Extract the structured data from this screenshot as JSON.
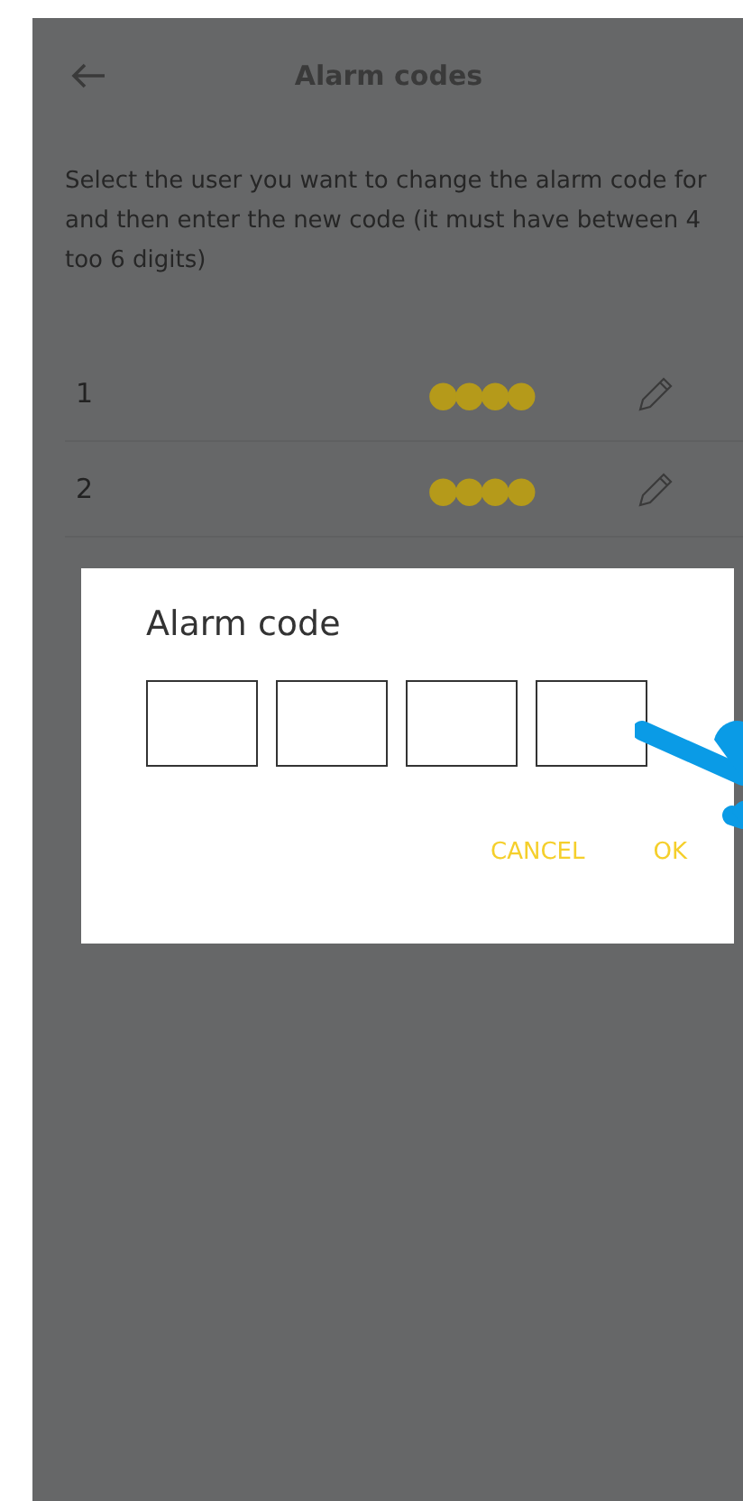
{
  "header": {
    "title": "Alarm codes"
  },
  "description": "Select the user you want to change the alarm code for and then enter the new code (it must have between 4 too 6 digits)",
  "users": [
    {
      "label": "1",
      "code": "●●●●"
    },
    {
      "label": "2",
      "code": "●●●●"
    }
  ],
  "dialog": {
    "title": "Alarm code",
    "code_fields": [
      {
        "filled": false
      },
      {
        "filled": false
      },
      {
        "filled": false
      },
      {
        "filled": false
      }
    ],
    "buttons": [
      "CANCEL",
      "OK"
    ]
  }
}
